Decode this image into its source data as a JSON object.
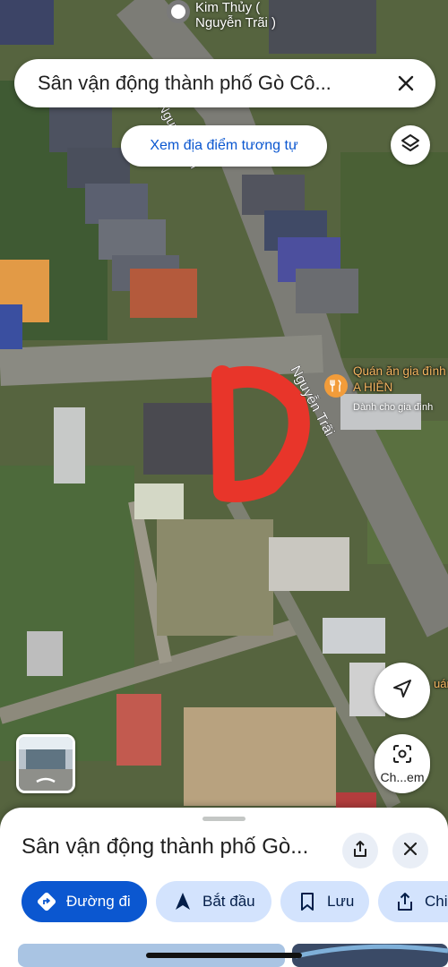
{
  "map": {
    "top_pin_label": "Kim Thủy (\nNguyễn Trãi )",
    "street_labels": [
      "Nguyễn Trãi",
      "Nguyễn Trãi"
    ],
    "poi": {
      "name": "Quán ăn gia đình A HIỀN",
      "subtitle": "Dành cho gia đình"
    },
    "edge_label": "uán",
    "drawn_marker_letter": "D",
    "colors": {
      "marker_red": "#e8352a",
      "poi_orange": "#f29c3a",
      "accent_blue": "#0b57d0"
    }
  },
  "search": {
    "query": "Sân vận động thành phố Gò Cô...",
    "close_icon": "close-icon"
  },
  "similar_places_label": "Xem địa điểm tương tự",
  "layers_icon": "layers-icon",
  "controls": {
    "location_icon": "navigation-arrow-icon",
    "lens_label": "Ch...em"
  },
  "sheet": {
    "title": "Sân vận động thành phố Gò...",
    "actions": [
      {
        "label": "Đường đi",
        "icon": "directions-icon"
      },
      {
        "label": "Bắt đầu",
        "icon": "navigation-icon"
      },
      {
        "label": "Lưu",
        "icon": "bookmark-icon"
      },
      {
        "label": "Chia",
        "icon": "share-icon"
      }
    ]
  }
}
